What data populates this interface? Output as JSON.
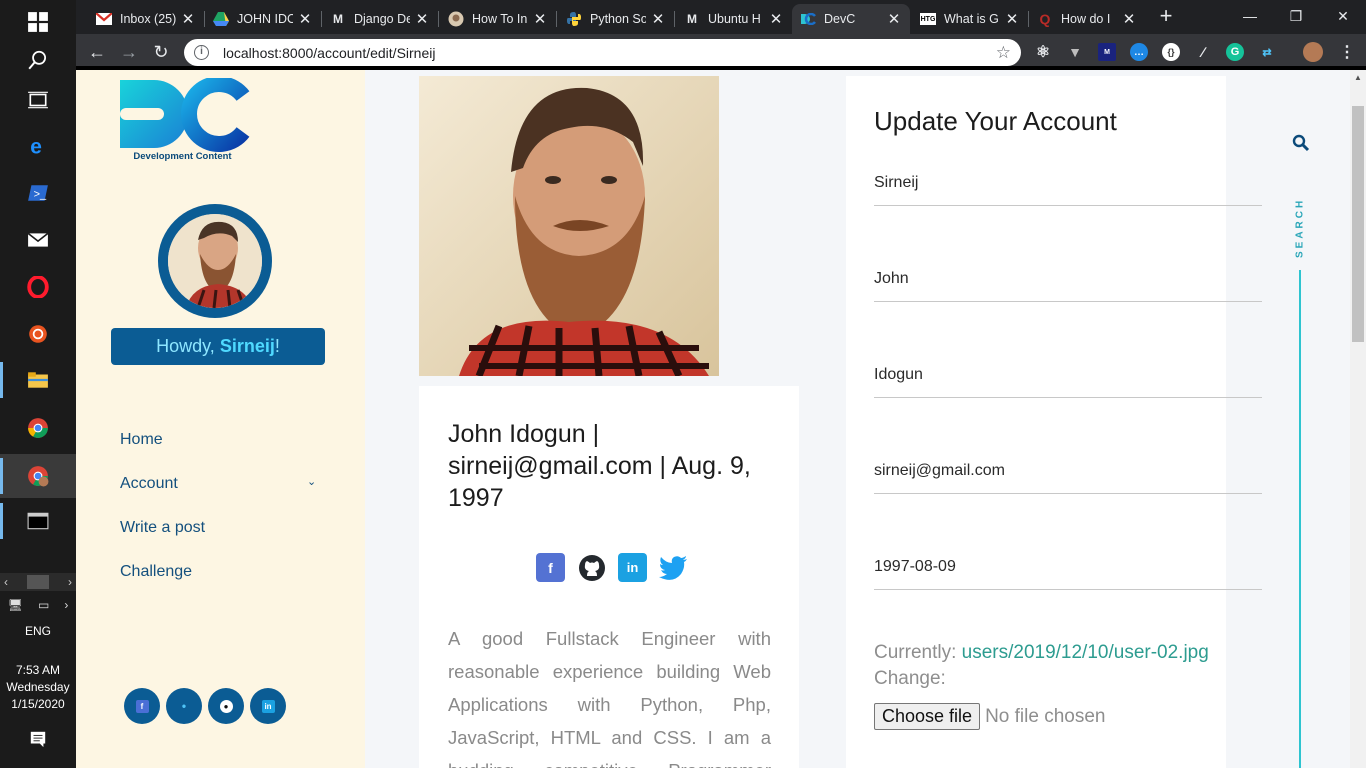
{
  "taskbar": {
    "lang": "ENG",
    "time": "7:53 AM",
    "day": "Wednesday",
    "date": "1/15/2020"
  },
  "tabs": [
    {
      "label": "Inbox (25)",
      "icon": "gmail-icon"
    },
    {
      "label": "JOHN IDO",
      "icon": "google-drive-icon"
    },
    {
      "label": "Django De",
      "icon": "medium-icon"
    },
    {
      "label": "How To In",
      "icon": "website-icon"
    },
    {
      "label": "Python So",
      "icon": "python-icon"
    },
    {
      "label": "Ubuntu H",
      "icon": "medium-icon"
    },
    {
      "label": "DevC",
      "icon": "devc-icon",
      "active": true
    },
    {
      "label": "What is G",
      "icon": "htg-icon"
    },
    {
      "label": "How do I",
      "icon": "quora-icon"
    }
  ],
  "browser": {
    "url": "localhost:8000/account/edit/Sirneij"
  },
  "sidebar": {
    "logo_text": "Development Content",
    "howdy_prefix": "Howdy, ",
    "username": "Sirneij",
    "howdy_suffix": "!",
    "nav": [
      {
        "label": "Home"
      },
      {
        "label": "Account"
      },
      {
        "label": "Write a post"
      },
      {
        "label": "Challenge"
      }
    ]
  },
  "profile": {
    "title": "John Idogun | sirneij@gmail.com | Aug. 9, 1997",
    "bio": "A good Fullstack Engineer with reasonable experience building Web Applications with Python, Php, JavaScript, HTML and CSS. I am a budding competitive Programmer"
  },
  "form": {
    "title": "Update Your Account",
    "fields": [
      {
        "value": "Sirneij"
      },
      {
        "value": "John"
      },
      {
        "value": "Idogun"
      },
      {
        "value": "sirneij@gmail.com"
      },
      {
        "value": "1997-08-09"
      }
    ],
    "currently_label": "Currently: ",
    "currently_link": "users/2019/12/10/user-02.jpg",
    "change_label": "Change:",
    "choose_file": "Choose file",
    "no_file": "No file chosen"
  },
  "search_rail": {
    "label": "SEARCH"
  },
  "colors": {
    "brand_blue": "#0b5c94",
    "accent_cyan": "#2ec4d0",
    "sidebar_bg": "#fdf6e3",
    "link_teal": "#2d9c90"
  }
}
